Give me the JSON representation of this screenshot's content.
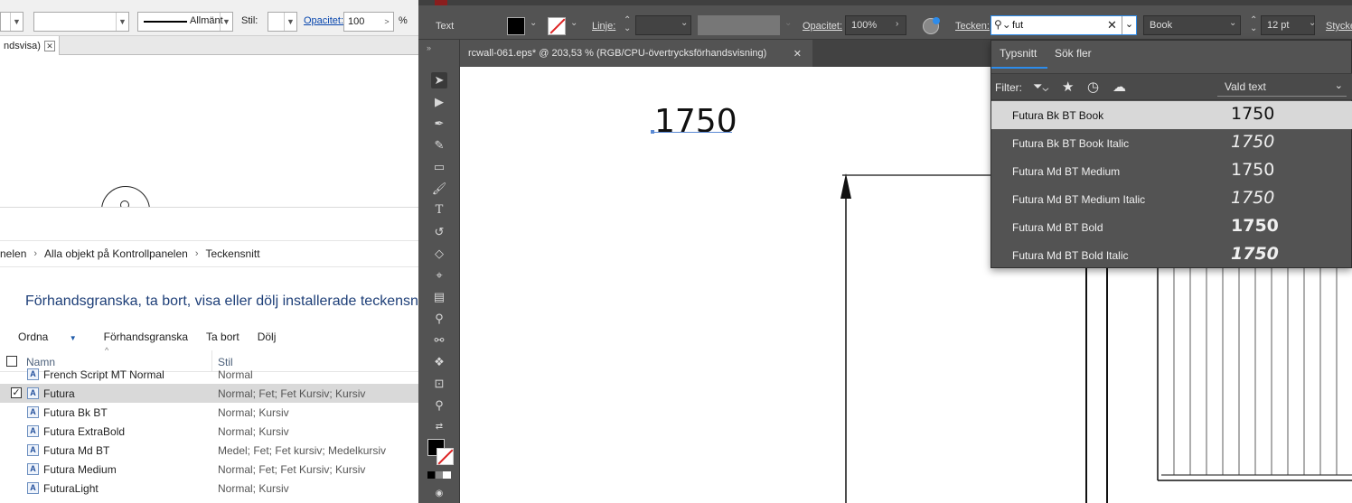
{
  "left_window": {
    "toolbar": {
      "stroke_label": "Allmänt",
      "style_label": "Stil:",
      "opacity_label": "Opacitet:",
      "opacity_value": "100",
      "percent": "%"
    },
    "tab": {
      "title": "ndsvisa)"
    },
    "explorer": {
      "breadcrumb": [
        "nelen",
        "Alla objekt på Kontrollpanelen",
        "Teckensnitt"
      ],
      "heading": "Förhandsgranska, ta bort, visa eller dölj installerade teckensnitt",
      "commands": [
        "Ordna",
        "Förhandsgranska",
        "Ta bort",
        "Dölj"
      ],
      "columns": {
        "name": "Namn",
        "style": "Stil"
      },
      "rows": [
        {
          "name": "French Script MT Normal",
          "style": "Normal",
          "checked": false,
          "selected": false
        },
        {
          "name": "Futura",
          "style": "Normal; Fet; Fet Kursiv; Kursiv",
          "checked": true,
          "selected": true
        },
        {
          "name": "Futura Bk BT",
          "style": "Normal; Kursiv",
          "checked": false,
          "selected": false
        },
        {
          "name": "Futura ExtraBold",
          "style": "Normal; Kursiv",
          "checked": false,
          "selected": false
        },
        {
          "name": "Futura Md BT",
          "style": "Medel; Fet; Fet kursiv; Medelkursiv",
          "checked": false,
          "selected": false
        },
        {
          "name": "Futura Medium",
          "style": "Normal; Fet; Fet Kursiv; Kursiv",
          "checked": false,
          "selected": false
        },
        {
          "name": "FuturaLight",
          "style": "Normal; Kursiv",
          "checked": false,
          "selected": false
        }
      ]
    }
  },
  "illustrator": {
    "control_bar": {
      "type_label": "Text",
      "stroke_label": "Linje:",
      "opacity_label": "Opacitet:",
      "opacity_value": "100%",
      "font_label": "Tecken:",
      "font_search_value": "fut",
      "font_style_value": "Book",
      "font_size_value": "12 pt",
      "paragraph_label": "Stycke"
    },
    "document_tab": {
      "title": "rcwall-061.eps* @ 203,53 % (RGB/CPU-övertrycksförhandsvisning)"
    },
    "canvas": {
      "text_object": "1750"
    },
    "font_dropdown": {
      "tabs": [
        "Typsnitt",
        "Sök fler"
      ],
      "filter_label": "Filter:",
      "sample_select": "Vald text",
      "fonts": [
        {
          "name": "Futura Bk BT Book",
          "preview": "1750",
          "weight": "normal",
          "italic": false,
          "selected": true
        },
        {
          "name": "Futura Bk BT Book Italic",
          "preview": "1750",
          "weight": "normal",
          "italic": true,
          "selected": false
        },
        {
          "name": "Futura Md BT Medium",
          "preview": "1750",
          "weight": "500",
          "italic": false,
          "selected": false
        },
        {
          "name": "Futura Md BT Medium Italic",
          "preview": "1750",
          "weight": "500",
          "italic": true,
          "selected": false
        },
        {
          "name": "Futura Md BT Bold",
          "preview": "1750",
          "weight": "bold",
          "italic": false,
          "selected": false
        },
        {
          "name": "Futura Md BT Bold Italic",
          "preview": "1750",
          "weight": "bold",
          "italic": true,
          "selected": false
        }
      ]
    }
  },
  "colors": {
    "ai_panel": "#535353",
    "ai_dark": "#424242",
    "accent_blue": "#2d8ceb",
    "explorer_heading": "#1e3f78"
  }
}
